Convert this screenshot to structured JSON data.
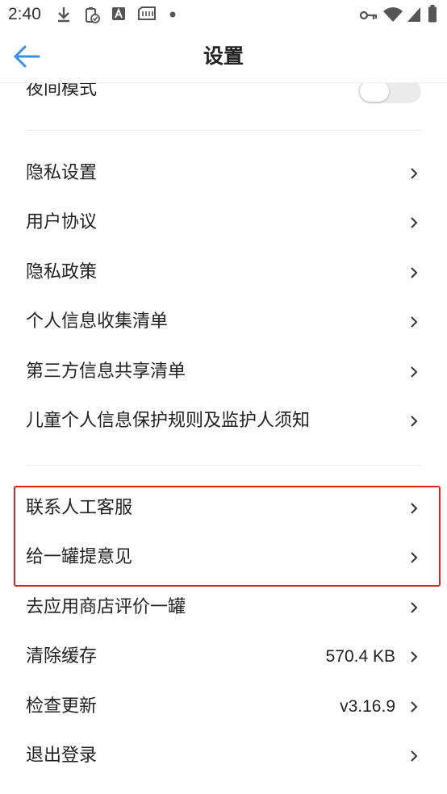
{
  "status_bar": {
    "time": "2:40"
  },
  "header": {
    "title": "设置"
  },
  "night_mode": {
    "label": "夜间模式",
    "enabled": false
  },
  "group1": [
    {
      "label": "隐私设置"
    },
    {
      "label": "用户协议"
    },
    {
      "label": "隐私政策"
    },
    {
      "label": "个人信息收集清单"
    },
    {
      "label": "第三方信息共享清单"
    },
    {
      "label": "儿童个人信息保护规则及监护人须知"
    }
  ],
  "group2": [
    {
      "label": "联系人工客服",
      "value": ""
    },
    {
      "label": "给一罐提意见",
      "value": ""
    },
    {
      "label": "去应用商店评价一罐",
      "value": ""
    },
    {
      "label": "清除缓存",
      "value": "570.4 KB"
    },
    {
      "label": "检查更新",
      "value": "v3.16.9"
    },
    {
      "label": "退出登录",
      "value": ""
    }
  ],
  "colors": {
    "accent": "#3a8ee6",
    "highlight": "#e02020"
  }
}
